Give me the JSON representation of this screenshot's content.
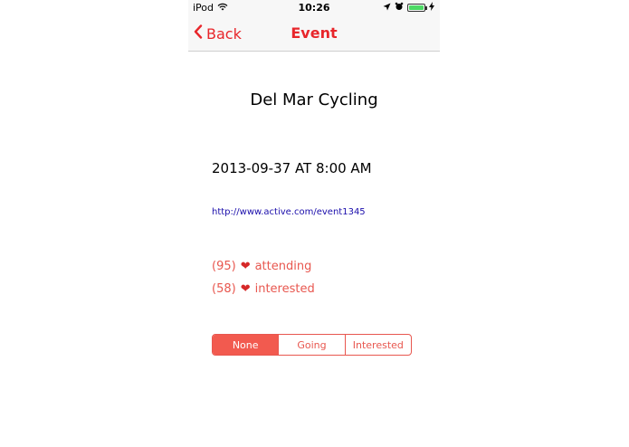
{
  "status_bar": {
    "carrier": "iPod",
    "time": "10:26"
  },
  "nav": {
    "back_label": "Back",
    "title": "Event"
  },
  "event": {
    "title": "Del Mar Cycling",
    "datetime": "2013-09-37 AT 8:00 AM",
    "link": "http://www.active.com/event1345",
    "attending_count": "(95)",
    "attending_label": "attending",
    "interested_count": "(58)",
    "interested_label": "interested"
  },
  "rsvp": {
    "options": [
      "None",
      "Going",
      "Interested"
    ],
    "selected": "None"
  },
  "colors": {
    "accent": "#e8262b",
    "segment_active": "#f25a4f",
    "link": "#1a0dab",
    "battery": "#4cd964"
  }
}
